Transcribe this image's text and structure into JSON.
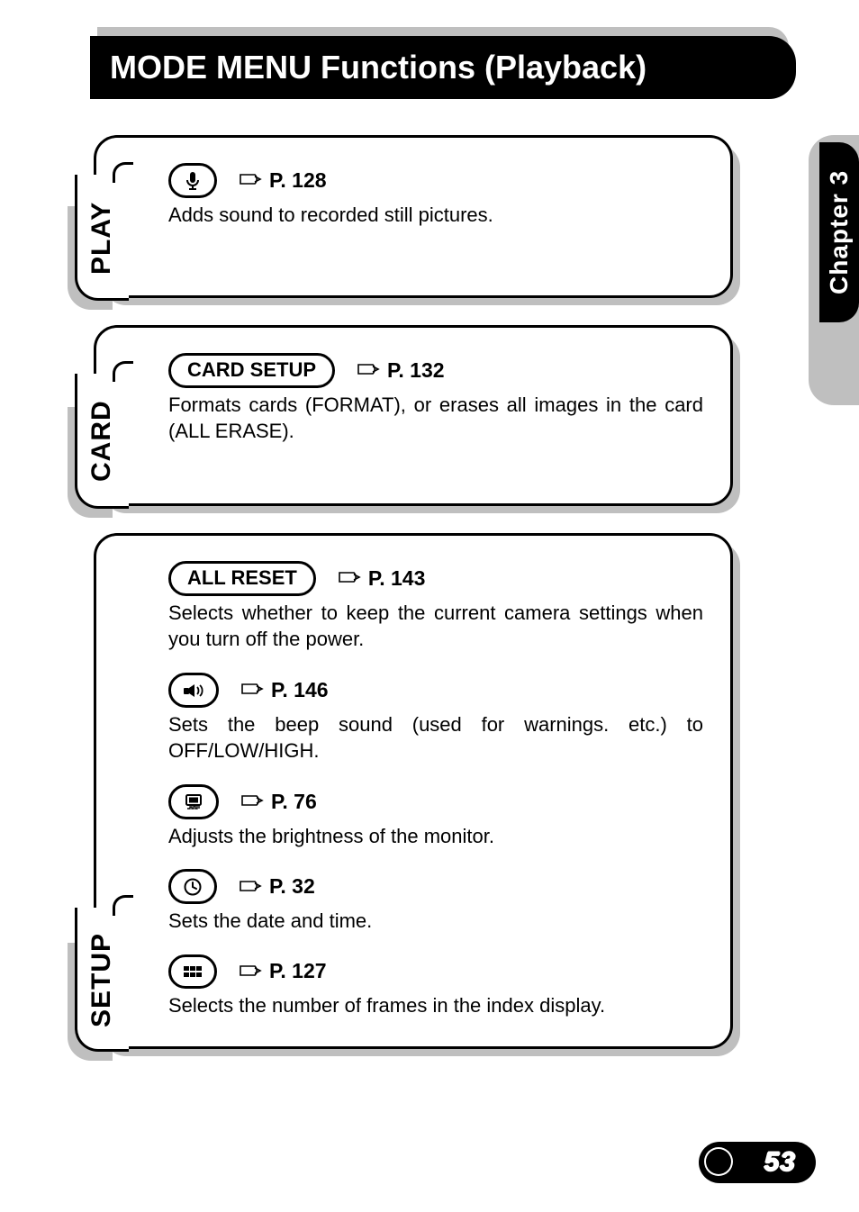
{
  "title": "MODE MENU Functions (Playback)",
  "chapter_label": "Chapter 3",
  "page_number": "53",
  "sections": {
    "play": {
      "tab": "PLAY",
      "items": [
        {
          "icon": "microphone",
          "page_ref": "P. 128",
          "desc": "Adds sound to recorded still pictures."
        }
      ]
    },
    "card": {
      "tab": "CARD",
      "items": [
        {
          "label": "CARD SETUP",
          "page_ref": "P. 132",
          "desc": "Formats cards (FORMAT), or erases all images in the card (ALL ERASE)."
        }
      ]
    },
    "setup": {
      "tab": "SETUP",
      "items": [
        {
          "label": "ALL RESET",
          "page_ref": "P. 143",
          "desc": "Selects whether to keep the current camera settings when you turn off the power."
        },
        {
          "icon": "beep",
          "page_ref": "P. 146",
          "desc": "Sets the beep sound (used for warnings. etc.) to OFF/LOW/HIGH."
        },
        {
          "icon": "monitor-brightness",
          "page_ref": "P. 76",
          "desc": "Adjusts the brightness of the monitor."
        },
        {
          "icon": "clock",
          "page_ref": "P. 32",
          "desc": "Sets the date and time."
        },
        {
          "icon": "index-grid",
          "page_ref": "P. 127",
          "desc": "Selects the number of frames in the index display."
        }
      ]
    }
  }
}
